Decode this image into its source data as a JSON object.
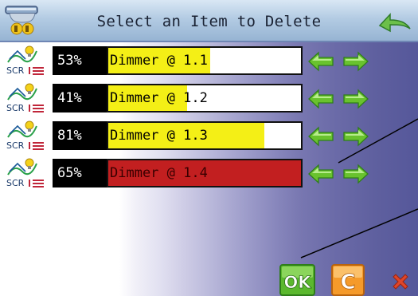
{
  "header": {
    "title": "Select an Item to Delete",
    "app_icon": "controller-device-icon",
    "back_icon": "back-arrow-icon"
  },
  "items": [
    {
      "percent": "53%",
      "label": "Dimmer @ 1.1",
      "level": 0.53,
      "selected": false,
      "icon": "scr-dimmer-icon"
    },
    {
      "percent": "41%",
      "label": "Dimmer @ 1.2",
      "level": 0.41,
      "selected": false,
      "icon": "scr-dimmer-icon"
    },
    {
      "percent": "81%",
      "label": "Dimmer @ 1.3",
      "level": 0.81,
      "selected": false,
      "icon": "scr-dimmer-icon"
    },
    {
      "percent": "65%",
      "label": "Dimmer @ 1.4",
      "level": 0.65,
      "selected": true,
      "icon": "scr-dimmer-icon"
    }
  ],
  "buttons": {
    "ok": "OK",
    "cancel": "C",
    "close": "close-icon"
  },
  "colors": {
    "level_fill": "#f4ef16",
    "selected": "#c21f20",
    "arrow": "#69c22e",
    "ok": "#5bb82e",
    "cancel": "#f59a2a",
    "close": "#e0462a"
  }
}
